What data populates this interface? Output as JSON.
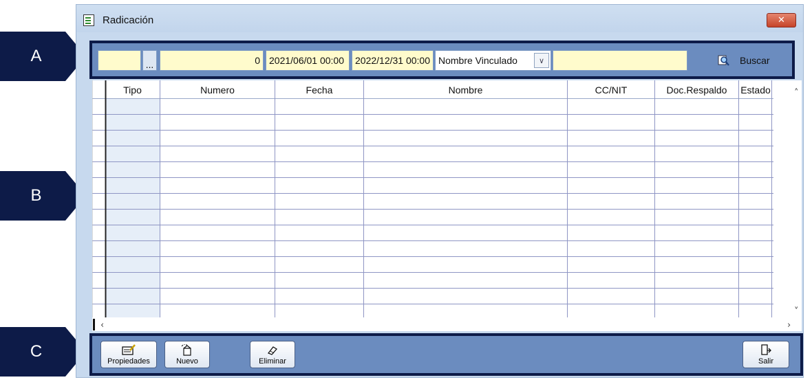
{
  "callouts": [
    "A",
    "B",
    "C"
  ],
  "window": {
    "title": "Radicación",
    "close_label": "✕"
  },
  "toolbar": {
    "field1_value": "",
    "ellipsis_label": "...",
    "number_value": "0",
    "date_from": "2021/06/01 00:00",
    "date_to": "2022/12/31 00:00",
    "filter_selected": "Nombre Vinculado",
    "search_value": "",
    "search_label": "Buscar",
    "search_icon": "magnifier-icon"
  },
  "grid": {
    "columns": [
      "Tipo",
      "Numero",
      "Fecha",
      "Nombre",
      "CC/NIT",
      "Doc.Respaldo",
      "Estado"
    ],
    "rows": []
  },
  "footer": {
    "buttons": [
      {
        "label": "Propiedades",
        "icon": "properties-icon"
      },
      {
        "label": "Nuevo",
        "icon": "new-icon"
      },
      {
        "label": "Eliminar",
        "icon": "eraser-icon"
      },
      {
        "label": "Salir",
        "icon": "exit-icon"
      }
    ]
  },
  "colors": {
    "accent": "#6b8cbf",
    "frame": "#0d1b48",
    "field": "#fffbcc"
  }
}
